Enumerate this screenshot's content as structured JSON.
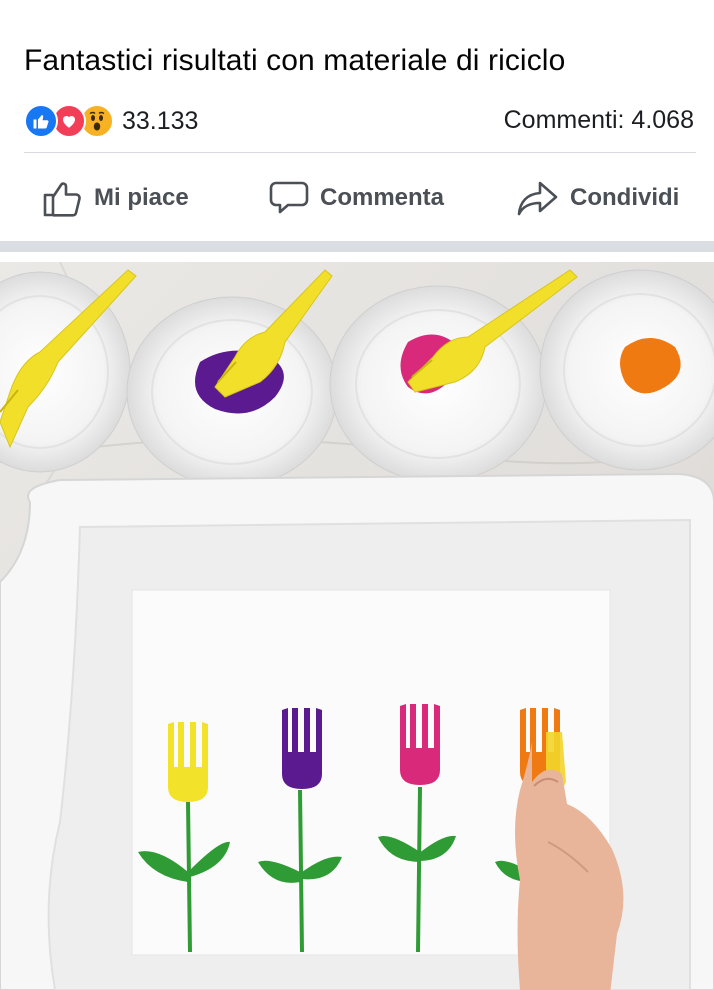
{
  "post": {
    "title": "Fantastici risultati con materiale di riciclo",
    "reaction_icons": [
      "like-icon",
      "love-icon",
      "wow-icon"
    ],
    "reaction_count": "33.133",
    "comments_label": "Commenti: 4.068"
  },
  "actions": {
    "like_label": "Mi piace",
    "comment_label": "Commenta",
    "share_label": "Condividi"
  },
  "colors": {
    "like_blue": "#1877f2",
    "love_red": "#f33e58",
    "wow_yellow": "#f7b125",
    "action_text": "#4b4f56",
    "separator": "#dadde1"
  },
  "photo": {
    "paint_colors": [
      "#f2e22a",
      "#5b1a8f",
      "#d8297a",
      "#f07a12"
    ],
    "stem_color": "#2f9b35"
  }
}
